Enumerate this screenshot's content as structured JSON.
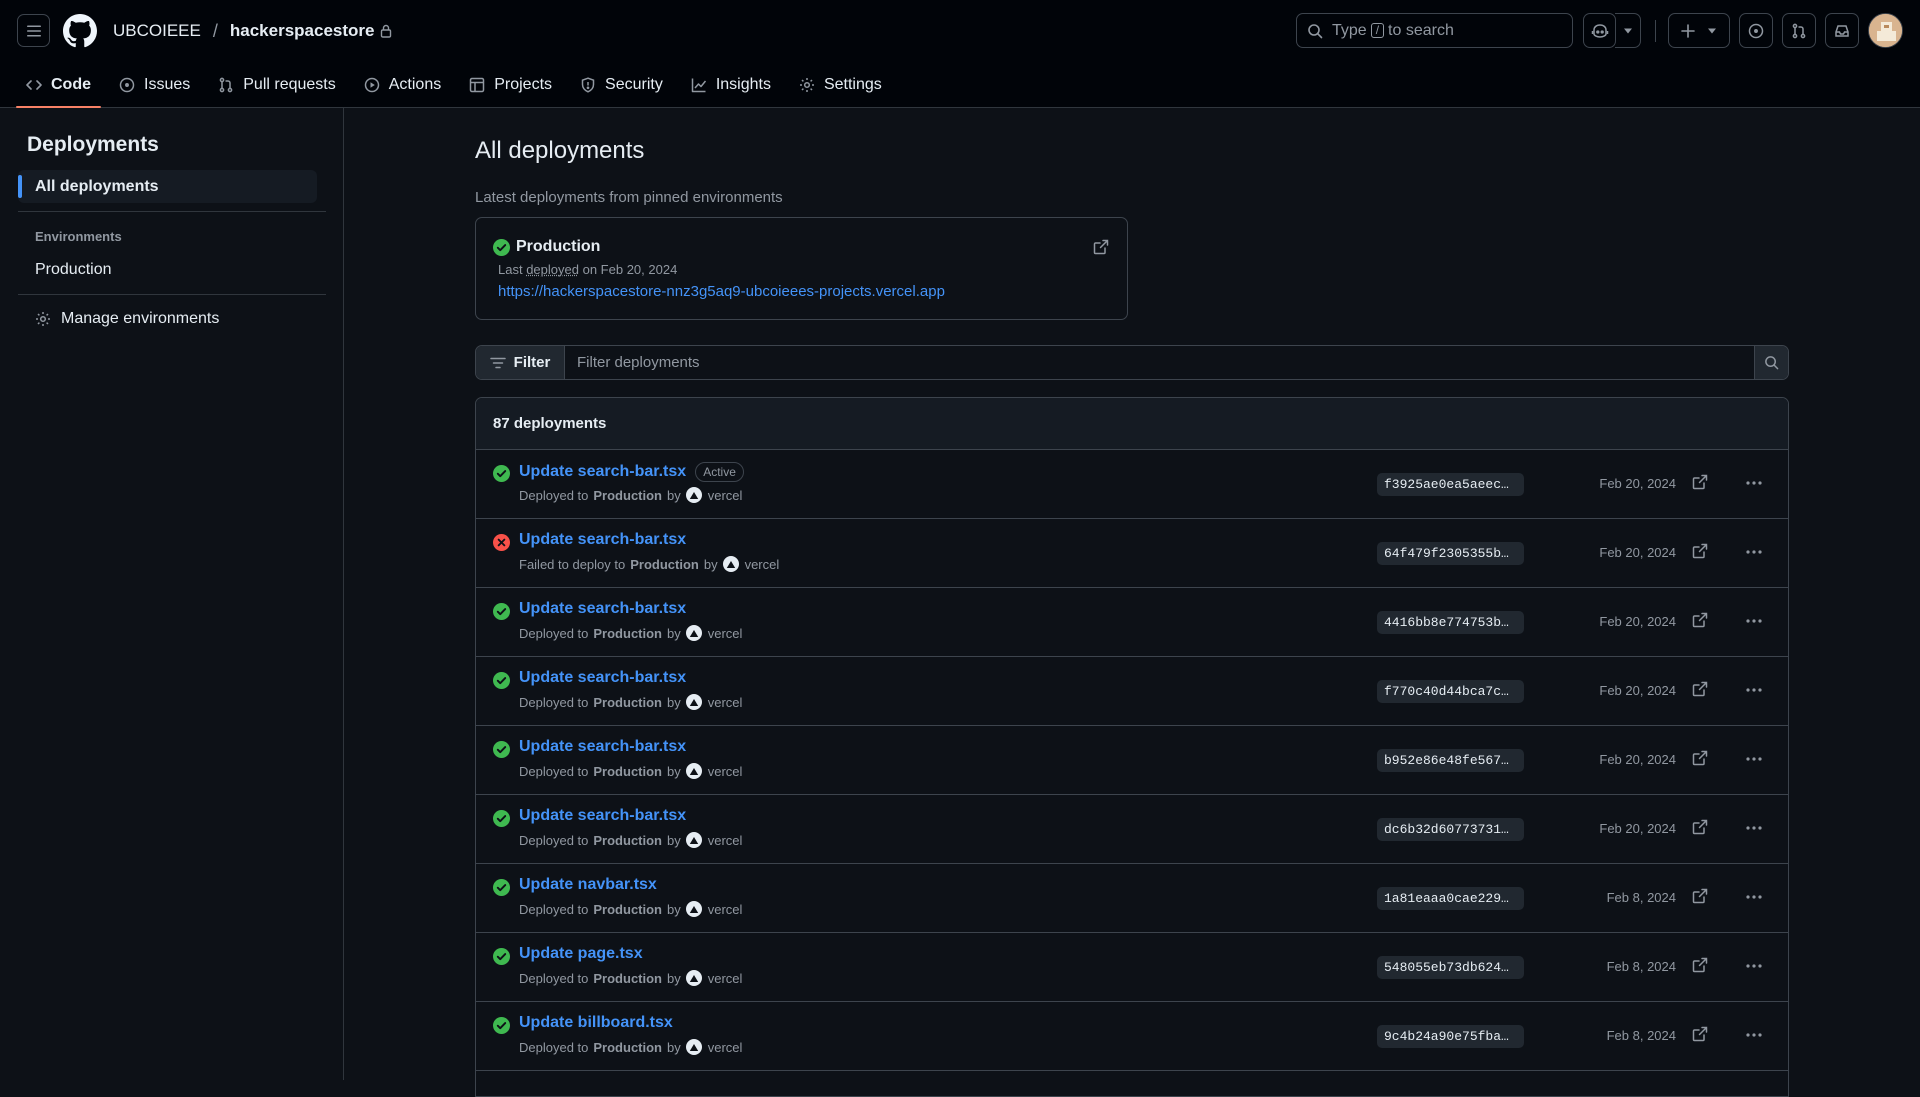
{
  "header": {
    "owner": "UBCOIEEE",
    "separator": "/",
    "repo": "hackerspacestore",
    "search_prefix": "Type",
    "search_key": "/",
    "search_suffix": "to search"
  },
  "tabs": [
    {
      "label": "Code",
      "icon": "code-icon",
      "selected": true
    },
    {
      "label": "Issues",
      "icon": "issue-icon"
    },
    {
      "label": "Pull requests",
      "icon": "pull-request-icon"
    },
    {
      "label": "Actions",
      "icon": "play-icon"
    },
    {
      "label": "Projects",
      "icon": "table-icon"
    },
    {
      "label": "Security",
      "icon": "shield-icon"
    },
    {
      "label": "Insights",
      "icon": "graph-icon"
    },
    {
      "label": "Settings",
      "icon": "gear-icon"
    }
  ],
  "sidebar": {
    "title": "Deployments",
    "active_item": "All deployments",
    "environments_heading": "Environments",
    "environment": "Production",
    "manage": "Manage environments"
  },
  "main": {
    "title": "All deployments",
    "subtitle": "Latest deployments from pinned environments",
    "pinned": {
      "env": "Production",
      "meta_prefix": "Last",
      "meta_link": "deployed",
      "meta_suffix": "on Feb 20, 2024",
      "url": "https://hackerspacestore-nnz3g5aq9-ubcoieees-projects.vercel.app"
    },
    "filter": {
      "label": "Filter",
      "placeholder": "Filter deployments"
    },
    "count": "87 deployments",
    "deployments": [
      {
        "title": "Update search-bar.tsx",
        "badge": "Active",
        "status": "success",
        "action": "Deployed to",
        "env": "Production",
        "by": "by",
        "actor": "vercel",
        "sha": "f3925ae0ea5aeec…",
        "date": "Feb 20, 2024"
      },
      {
        "title": "Update search-bar.tsx",
        "badge": "",
        "status": "failure",
        "action": "Failed to deploy to",
        "env": "Production",
        "by": "by",
        "actor": "vercel",
        "sha": "64f479f2305355b…",
        "date": "Feb 20, 2024"
      },
      {
        "title": "Update search-bar.tsx",
        "badge": "",
        "status": "success",
        "action": "Deployed to",
        "env": "Production",
        "by": "by",
        "actor": "vercel",
        "sha": "4416bb8e774753b…",
        "date": "Feb 20, 2024"
      },
      {
        "title": "Update search-bar.tsx",
        "badge": "",
        "status": "success",
        "action": "Deployed to",
        "env": "Production",
        "by": "by",
        "actor": "vercel",
        "sha": "f770c40d44bca7c…",
        "date": "Feb 20, 2024"
      },
      {
        "title": "Update search-bar.tsx",
        "badge": "",
        "status": "success",
        "action": "Deployed to",
        "env": "Production",
        "by": "by",
        "actor": "vercel",
        "sha": "b952e86e48fe567…",
        "date": "Feb 20, 2024"
      },
      {
        "title": "Update search-bar.tsx",
        "badge": "",
        "status": "success",
        "action": "Deployed to",
        "env": "Production",
        "by": "by",
        "actor": "vercel",
        "sha": "dc6b32d60773731…",
        "date": "Feb 20, 2024"
      },
      {
        "title": "Update navbar.tsx",
        "badge": "",
        "status": "success",
        "action": "Deployed to",
        "env": "Production",
        "by": "by",
        "actor": "vercel",
        "sha": "1a81eaaa0cae229…",
        "date": "Feb 8, 2024"
      },
      {
        "title": "Update page.tsx",
        "badge": "",
        "status": "success",
        "action": "Deployed to",
        "env": "Production",
        "by": "by",
        "actor": "vercel",
        "sha": "548055eb73db624…",
        "date": "Feb 8, 2024"
      },
      {
        "title": "Update billboard.tsx",
        "badge": "",
        "status": "success",
        "action": "Deployed to",
        "env": "Production",
        "by": "by",
        "actor": "vercel",
        "sha": "9c4b24a90e75fba…",
        "date": "Feb 8, 2024"
      }
    ]
  },
  "colors": {
    "success": "#3fb950",
    "failure": "#f85149",
    "link": "#4493f8",
    "tab_underline": "#f78166"
  }
}
